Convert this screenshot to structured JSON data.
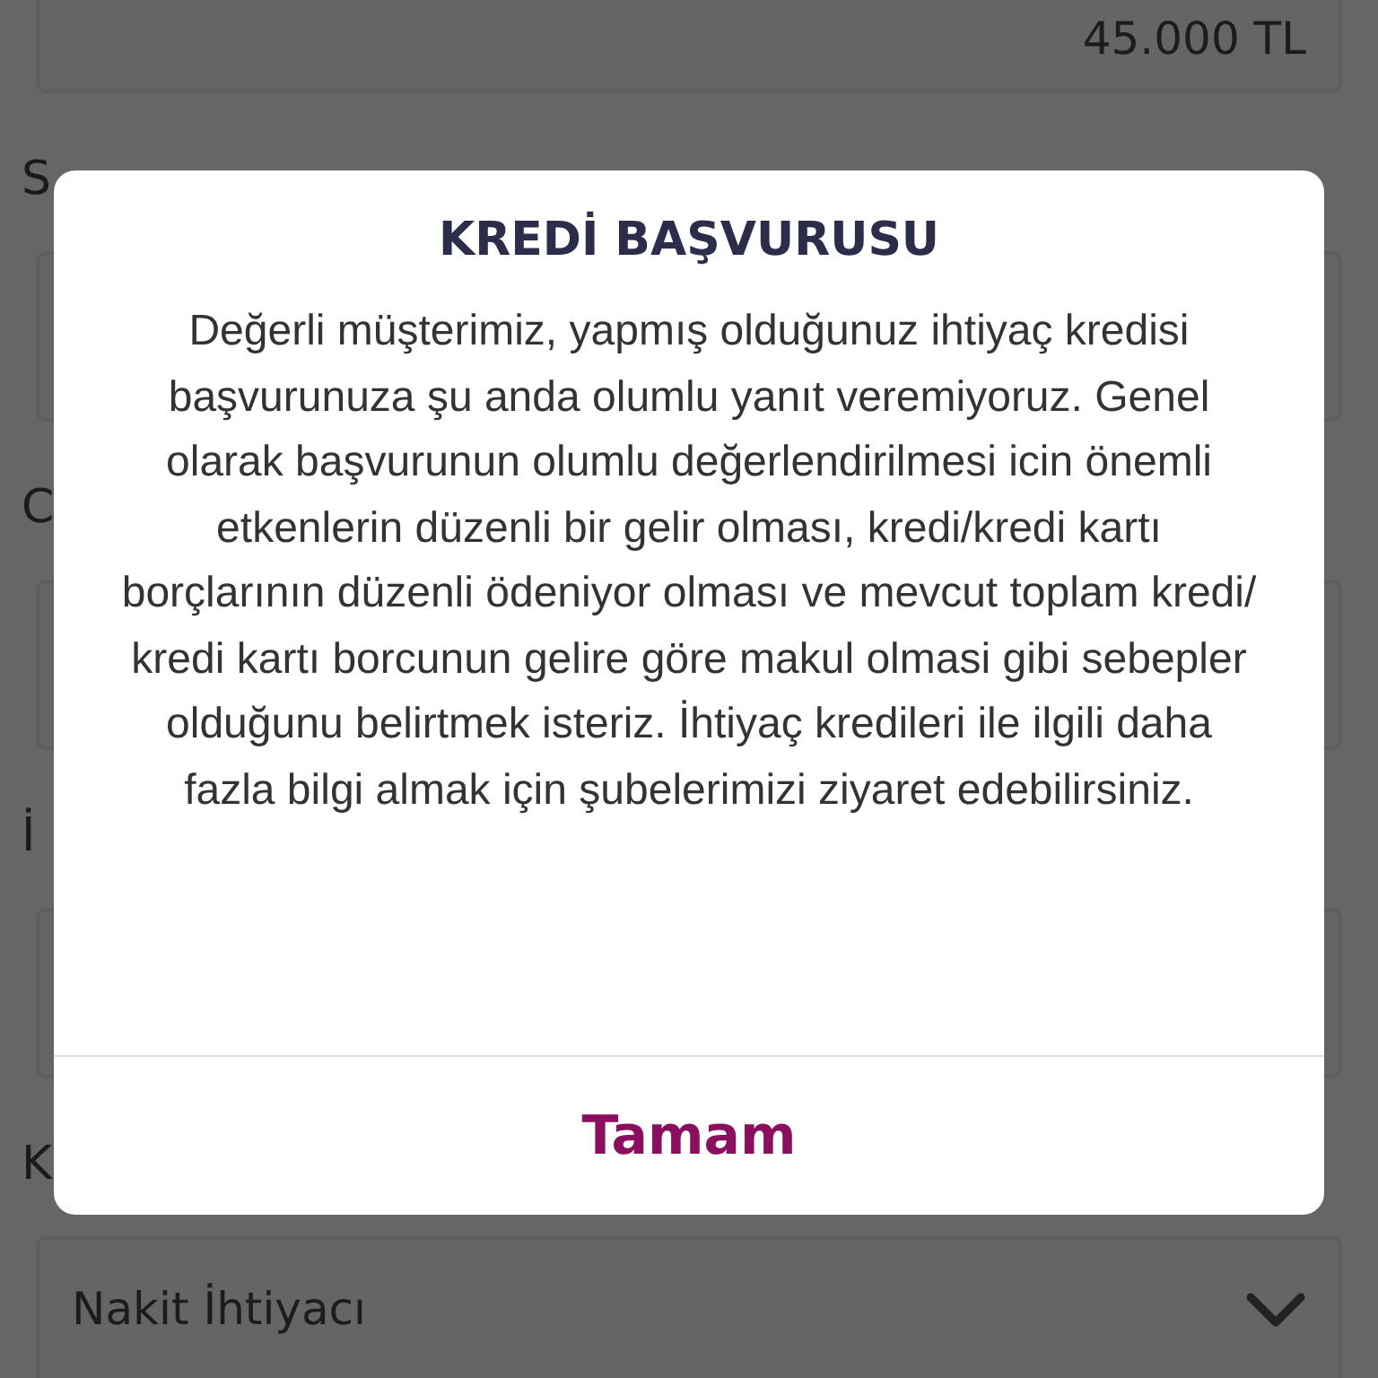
{
  "form": {
    "fields": [
      {
        "value": "45.000 TL",
        "kind": "amount"
      },
      {
        "label": "S",
        "kind": "text"
      },
      {
        "label": "C",
        "kind": "text"
      },
      {
        "label": "İ",
        "kind": "text"
      },
      {
        "label": "K",
        "value": "Nakit İhtiyacı",
        "kind": "dropdown"
      }
    ]
  },
  "dialog": {
    "title": "KREDİ BAŞVURUSU",
    "message": "Değerli müşterimiz, yapmış olduğunuz ihtiyaç kredisi başvurunuza şu anda olumlu yanıt veremiyoruz. Genel olarak başvurunun olumlu değerlendirilmesi icin önemli etkenlerin düzenli bir gelir olması,  kredi/kredi kartı borçlarının düzenli ödeniyor olması ve mevcut toplam kredi/ kredi kartı borcunun gelire göre makul olmasi gibi sebepler olduğunu belirtmek isteriz. İhtiyaç kredileri ile ilgili daha fazla bilgi almak için şubelerimizi ziyaret edebilirsiniz.",
    "button": "Tamam"
  }
}
